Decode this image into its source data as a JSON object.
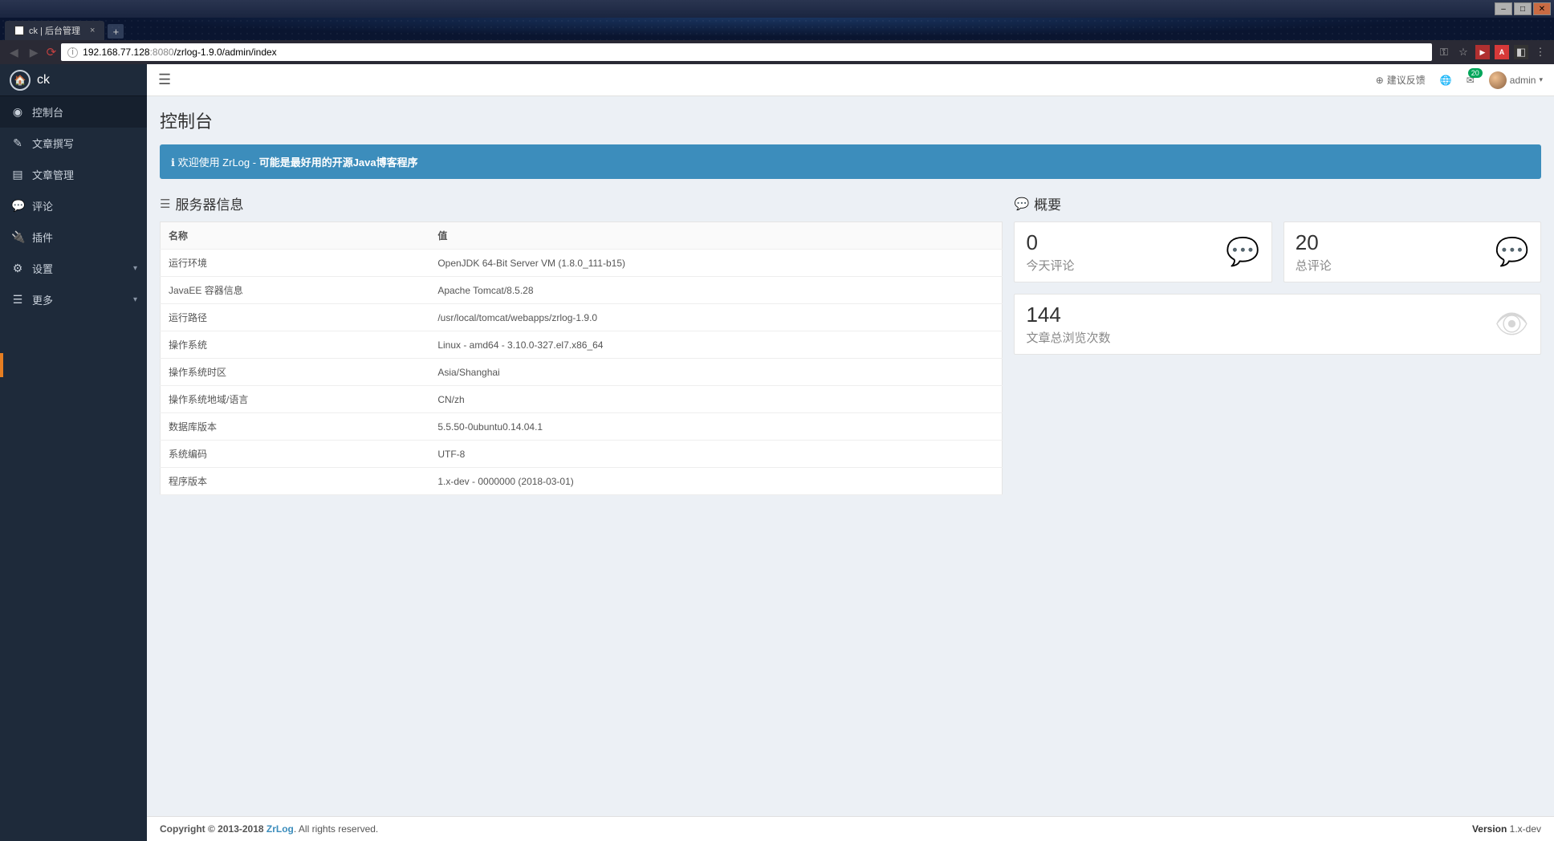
{
  "os": {
    "title": "ck | 后台管理"
  },
  "browser": {
    "tab_title": "ck | 后台管理",
    "url_host": "192.168.77.128",
    "url_port": ":8080",
    "url_path": "/zrlog-1.9.0/admin/index"
  },
  "brand": {
    "name": "ck"
  },
  "sidebar": {
    "items": [
      {
        "icon": "dashboard",
        "label": "控制台"
      },
      {
        "icon": "edit",
        "label": "文章撰写"
      },
      {
        "icon": "list",
        "label": "文章管理"
      },
      {
        "icon": "comments",
        "label": "评论"
      },
      {
        "icon": "plug",
        "label": "插件"
      },
      {
        "icon": "cogs",
        "label": "设置",
        "chev": true
      },
      {
        "icon": "more",
        "label": "更多",
        "chev": true
      }
    ]
  },
  "topbar": {
    "feedback": "建议反馈",
    "badge": "20",
    "user": "admin"
  },
  "page": {
    "title": "控制台",
    "alert_prefix": "欢迎使用 ZrLog - ",
    "alert_strong": "可能是最好用的开源Java博客程序",
    "server_info_title": "服务器信息",
    "table_headers": {
      "name": "名称",
      "value": "值"
    },
    "server_rows": [
      {
        "k": "运行环境",
        "v": "OpenJDK 64-Bit Server VM (1.8.0_111-b15)"
      },
      {
        "k": "JavaEE 容器信息",
        "v": "Apache Tomcat/8.5.28"
      },
      {
        "k": "运行路径",
        "v": "/usr/local/tomcat/webapps/zrlog-1.9.0"
      },
      {
        "k": "操作系统",
        "v": "Linux - amd64 - 3.10.0-327.el7.x86_64"
      },
      {
        "k": "操作系统时区",
        "v": "Asia/Shanghai"
      },
      {
        "k": "操作系统地域/语言",
        "v": "CN/zh"
      },
      {
        "k": "数据库版本",
        "v": "5.5.50-0ubuntu0.14.04.1"
      },
      {
        "k": "系统编码",
        "v": "UTF-8"
      },
      {
        "k": "程序版本",
        "v": "1.x-dev - 0000000 (2018-03-01)"
      }
    ],
    "summary_title": "概要",
    "stats": [
      {
        "num": "0",
        "label": "今天评论",
        "icon": "comment"
      },
      {
        "num": "20",
        "label": "总评论",
        "icon": "comment"
      },
      {
        "num": "144",
        "label": "文章总浏览次数",
        "icon": "eye"
      }
    ]
  },
  "footer": {
    "copyright_prefix": "Copyright © 2013-2018 ",
    "copyright_link": "ZrLog",
    "copyright_suffix": ". All rights reserved.",
    "version_label": "Version ",
    "version_value": "1.x-dev"
  }
}
